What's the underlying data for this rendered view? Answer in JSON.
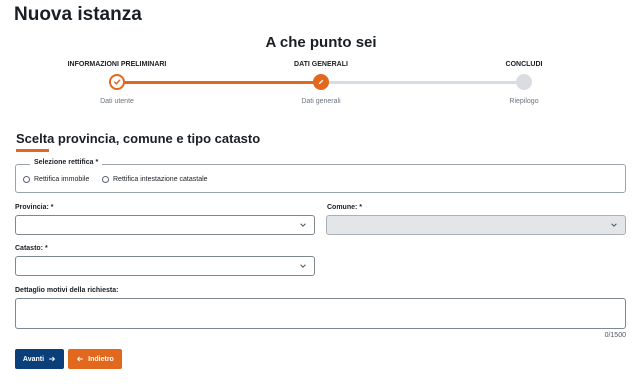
{
  "page": {
    "title": "Nuova istanza"
  },
  "progress": {
    "title": "A che punto sei",
    "steps": [
      {
        "label": "INFORMAZIONI PRELIMINARI",
        "sublabel": "Dati utente",
        "state": "completed"
      },
      {
        "label": "DATI GENERALI",
        "sublabel": "Dati generali",
        "state": "active"
      },
      {
        "label": "CONCLUDI",
        "sublabel": "Riepilogo",
        "state": "todo"
      }
    ],
    "colors": {
      "accent": "#e2681d",
      "inactive": "#d9dde1"
    }
  },
  "section": {
    "title": "Scelta provincia, comune e tipo catasto"
  },
  "rettifica": {
    "legend": "Selezione rettifica *",
    "options": [
      "Rettifica immobile",
      "Rettifica intestazione catastale"
    ]
  },
  "fields": {
    "provincia": {
      "label": "Provincia: *",
      "value": ""
    },
    "comune": {
      "label": "Comune: *",
      "value": "",
      "disabled": true
    },
    "catasto": {
      "label": "Catasto: *",
      "value": ""
    },
    "dettaglio": {
      "label": "Dettaglio motivi della richiesta:",
      "value": "",
      "counter": "0/1500"
    }
  },
  "buttons": {
    "next": {
      "label": "Avanti",
      "icon": "arrow-right-icon",
      "color": "#0b3f7a"
    },
    "back": {
      "label": "Indietro",
      "icon": "arrow-left-icon",
      "color": "#e2681d"
    }
  }
}
